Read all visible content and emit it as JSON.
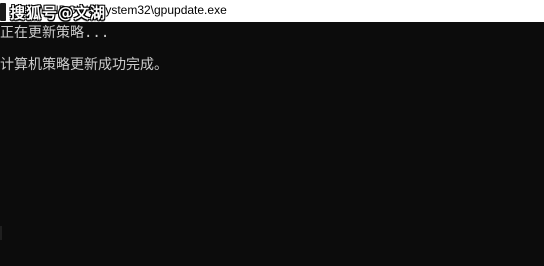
{
  "window": {
    "title": "C:\\WINDOWS\\system32\\gpupdate.exe",
    "watermark_text": "搜狐号@文湖"
  },
  "console": {
    "lines": [
      "正在更新策略...",
      "计算机策略更新成功完成。"
    ]
  },
  "colors": {
    "console_background": "#0c0c0c",
    "console_text": "#cccccc",
    "titlebar_background": "#ffffff"
  }
}
